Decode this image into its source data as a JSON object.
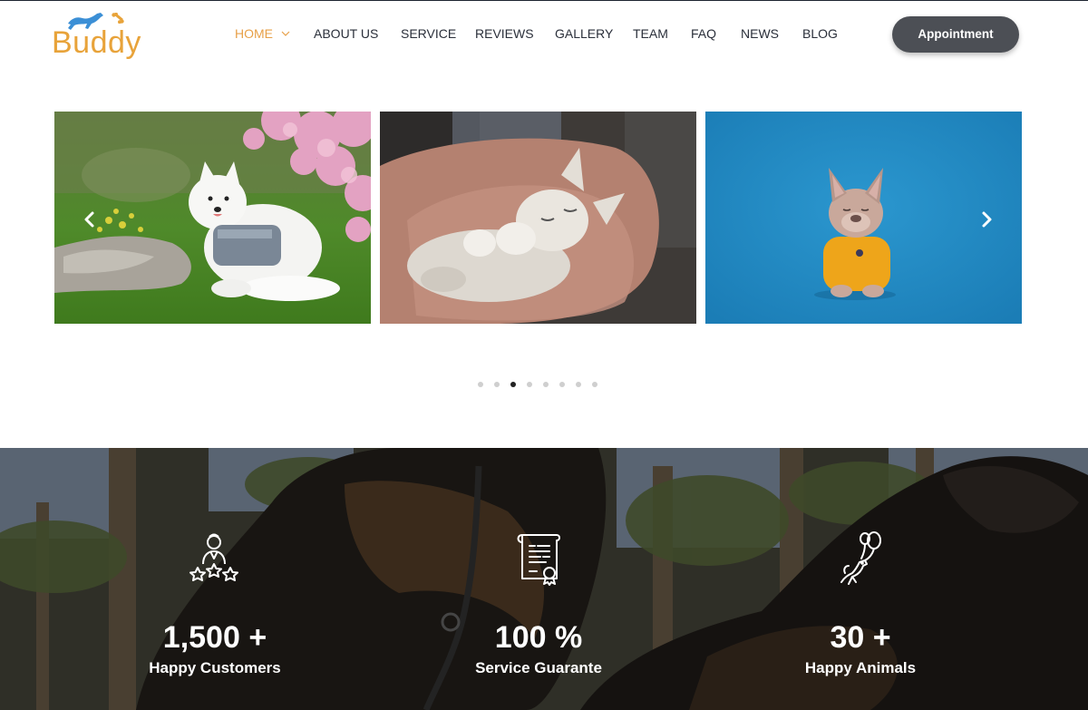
{
  "brand": {
    "name": "Buddy",
    "color": "#e8a33a",
    "accent": "#3b8fd6"
  },
  "nav": {
    "items": [
      {
        "label": "HOME",
        "active": true
      },
      {
        "label": "ABOUT US"
      },
      {
        "label": "SERVICE"
      },
      {
        "label": "REVIEWS"
      },
      {
        "label": "GALLERY"
      },
      {
        "label": "TEAM"
      },
      {
        "label": "FAQ"
      },
      {
        "label": "NEWS"
      },
      {
        "label": "BLOG"
      }
    ],
    "active_color": "#e7a048",
    "cta_label": "Appointment"
  },
  "slider": {
    "slides": [
      {
        "subject": "white dog in garden"
      },
      {
        "subject": "kitten sleeping on arm"
      },
      {
        "subject": "french bulldog in yellow shirt"
      }
    ],
    "prev_icon": "chevron-left-icon",
    "next_icon": "chevron-right-icon",
    "dot_count": 8,
    "active_dot": 3
  },
  "stats": [
    {
      "value": "1,500 +",
      "label": "Happy Customers",
      "icon": "customer-rating-icon"
    },
    {
      "value": "100 %",
      "label": "Service Guarante",
      "icon": "certificate-icon"
    },
    {
      "value": "30 +",
      "label": "Happy Animals",
      "icon": "dog-balloon-icon"
    }
  ]
}
